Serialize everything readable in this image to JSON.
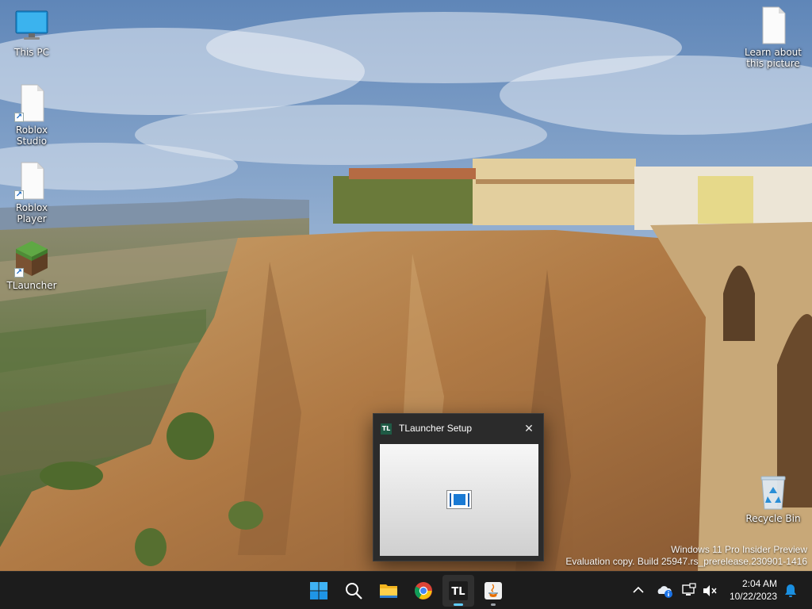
{
  "desktop": {
    "icons_left": [
      {
        "label": "This PC",
        "icon": "monitor-icon"
      },
      {
        "label": "Roblox Studio",
        "icon": "file-shortcut-icon"
      },
      {
        "label": "Roblox Player",
        "icon": "file-shortcut-icon"
      },
      {
        "label": "TLauncher",
        "icon": "grass-block-icon"
      }
    ],
    "learn_about": {
      "label_line1": "Learn about",
      "label_line2": "this picture",
      "icon": "file-icon"
    },
    "recycle_bin": {
      "label": "Recycle Bin",
      "icon": "recycle-bin-icon"
    }
  },
  "watermark": {
    "line1": "Windows 11 Pro Insider Preview",
    "line2": "Evaluation copy. Build 25947.rs_prerelease.230901-1416"
  },
  "setup_window": {
    "app_icon_text": "TL",
    "title": "TLauncher Setup",
    "close_glyph": "✕"
  },
  "taskbar": {
    "apps": [
      {
        "name": "start",
        "icon": "windows-logo-icon"
      },
      {
        "name": "search",
        "icon": "search-icon"
      },
      {
        "name": "file-explorer",
        "icon": "folder-icon"
      },
      {
        "name": "chrome",
        "icon": "chrome-icon"
      },
      {
        "name": "tlauncher",
        "icon": "tlauncher-icon",
        "text": "TL"
      },
      {
        "name": "java-installer",
        "icon": "java-icon"
      }
    ],
    "tray": {
      "chevron": "show-hidden-icons",
      "time": "2:04 AM",
      "date": "10/22/2023"
    }
  },
  "colors": {
    "taskbar_bg": "#1c1c1c",
    "window_bg": "#2b2b2b",
    "accent": "#60cdff"
  }
}
